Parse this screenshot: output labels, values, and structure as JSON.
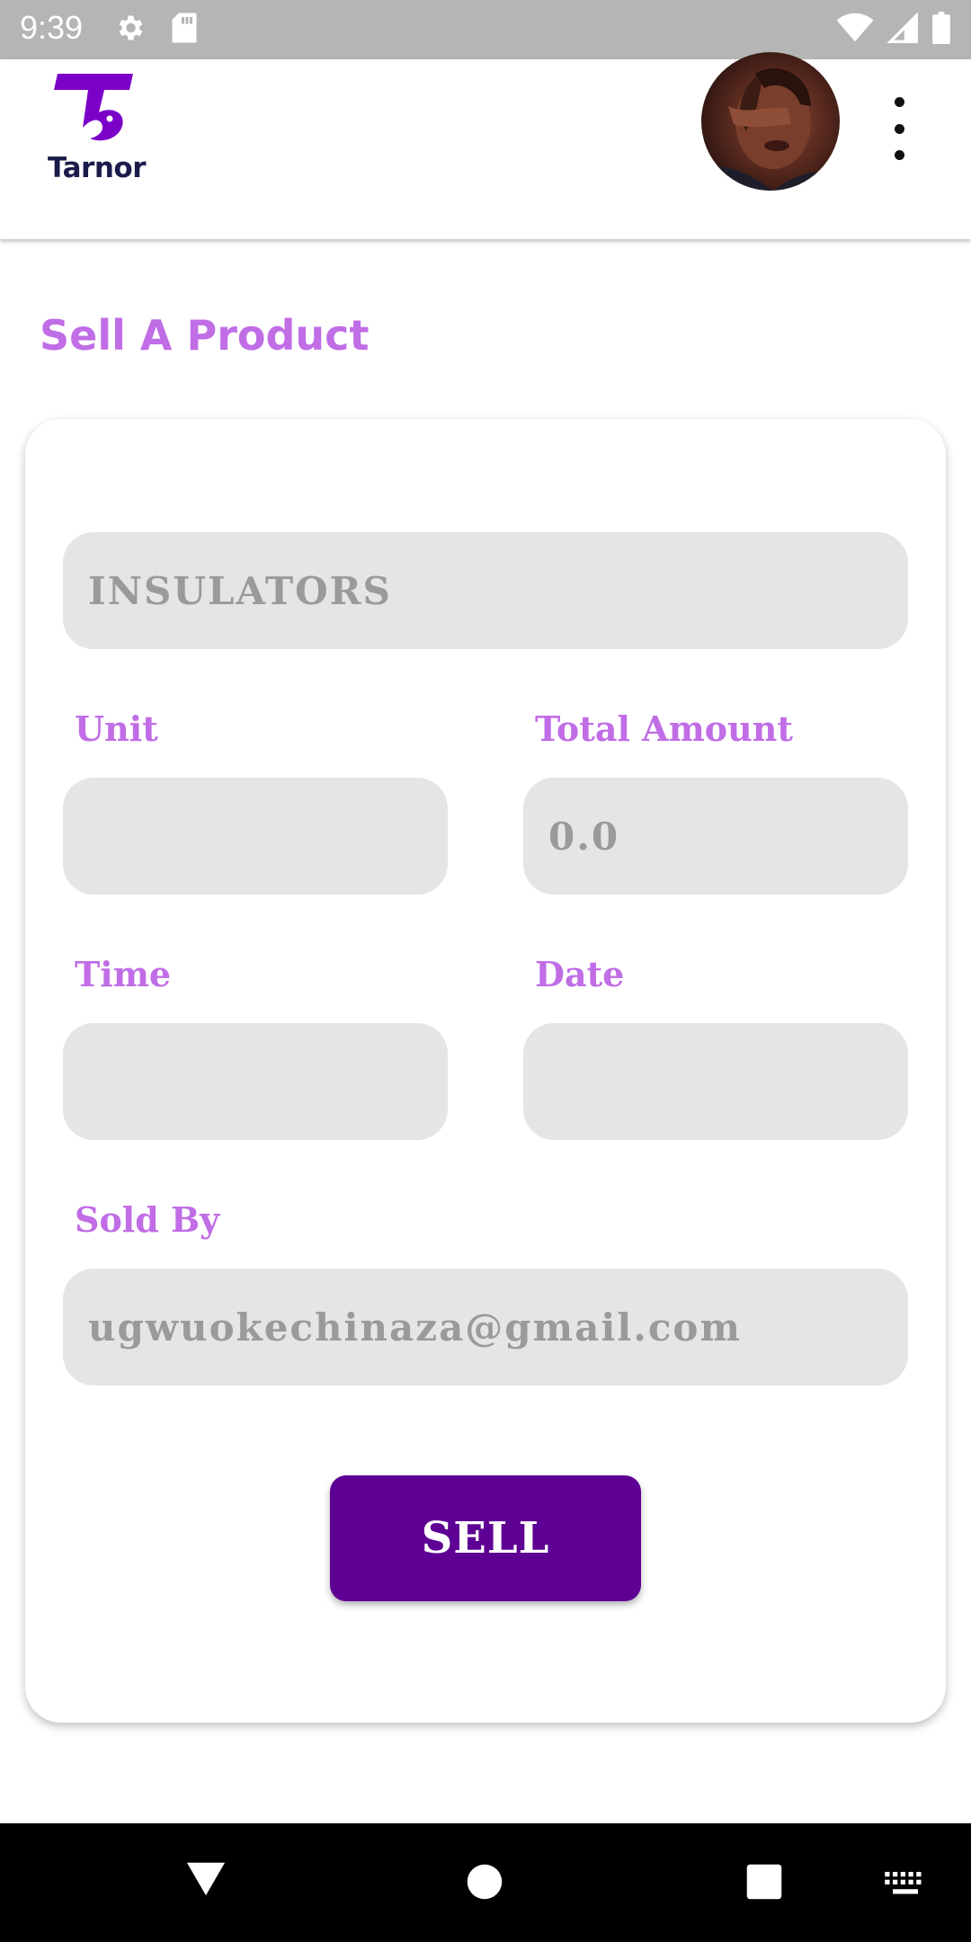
{
  "status_bar": {
    "time": "9:39",
    "left_icons": [
      "gear-icon",
      "sd-card-icon"
    ],
    "right_icons": [
      "wifi-icon",
      "signal-icon",
      "battery-icon"
    ]
  },
  "app_bar": {
    "logo_text": "Tarnor",
    "brand_color": "#7b00c8",
    "menu_icon": "more-vert-icon"
  },
  "page": {
    "title": "Sell A Product"
  },
  "form": {
    "product": {
      "value": "INSULATORS"
    },
    "unit": {
      "label": "Unit",
      "value": ""
    },
    "total_amount": {
      "label": "Total Amount",
      "value": "0.0"
    },
    "time": {
      "label": "Time",
      "value": ""
    },
    "date": {
      "label": "Date",
      "value": ""
    },
    "sold_by": {
      "label": "Sold By",
      "value": "ugwuokechinaza@gmail.com"
    },
    "sell_button_label": "SELL"
  },
  "colors": {
    "accent_text": "#c06de6",
    "button": "#5e0093",
    "field_bg": "#e5e5e5"
  },
  "nav_bar": {
    "icons": [
      "back-icon",
      "home-icon",
      "recents-icon",
      "keyboard-icon"
    ]
  }
}
